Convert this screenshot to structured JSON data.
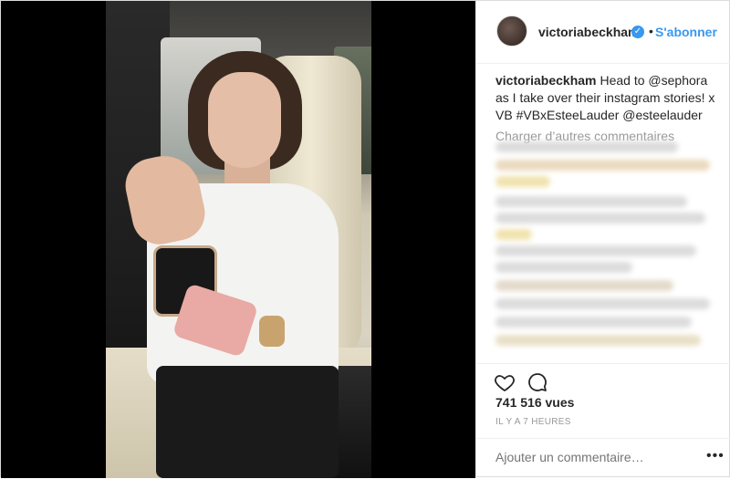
{
  "post": {
    "username": "victoriabeckham",
    "dot": "•",
    "follow_label": "S'abonner",
    "caption": "Head to @sephora as I take over their instagram stories! x VB #VBxEsteeLauder @esteelauder",
    "load_more": "Charger d’autres commentaires",
    "views": "741 516 vues",
    "time": "IL Y A 7 HEURES",
    "add_comment_placeholder": "Ajouter un commentaire…",
    "more_label": "•••"
  },
  "icons": {
    "verified": "verified-badge-icon",
    "like": "heart-icon",
    "comment": "comment-bubble-icon",
    "more": "more-options-icon"
  },
  "colors": {
    "accent": "#3897f0",
    "text": "#262626",
    "muted": "#999999",
    "border": "#efefef"
  }
}
